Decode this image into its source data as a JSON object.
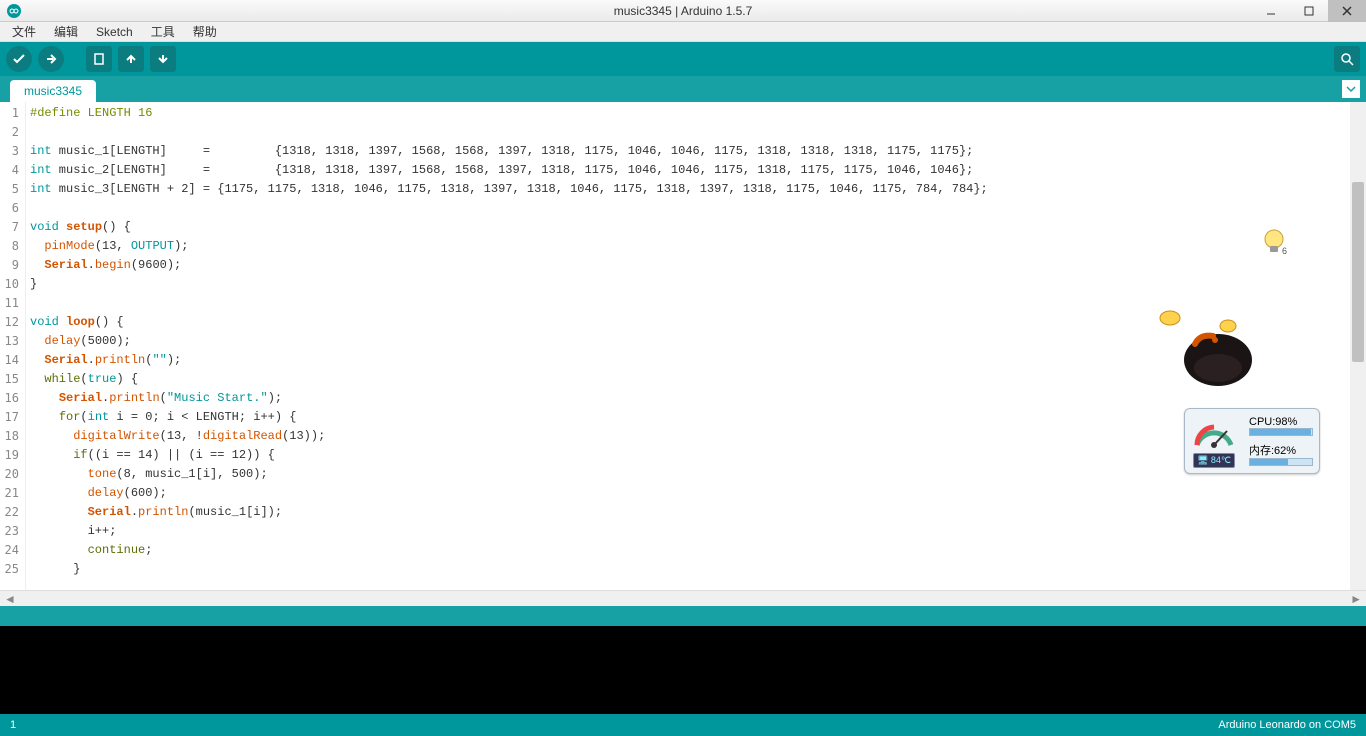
{
  "window": {
    "title": "music3345 | Arduino 1.5.7"
  },
  "menu": {
    "file": "文件",
    "edit": "编辑",
    "sketch": "Sketch",
    "tools": "工具",
    "help": "帮助"
  },
  "tab": {
    "name": "music3345"
  },
  "status": {
    "line": "1",
    "board": "Arduino Leonardo on COM5"
  },
  "gauge": {
    "cpu_label": "CPU:98%",
    "mem_label": "内存:62%",
    "temp": "84℃",
    "cpu_pct": 98,
    "mem_pct": 62
  },
  "bulb_badge": "6",
  "code_lines": [
    {
      "n": 1,
      "html": "<span class='kw-pre'>#define LENGTH 16</span>"
    },
    {
      "n": 2,
      "html": ""
    },
    {
      "n": 3,
      "html": "<span class='kw-type'>int</span> music_1[LENGTH]     =         {1318, 1318, 1397, 1568, 1568, 1397, 1318, 1175, 1046, 1046, 1175, 1318, 1318, 1318, 1175, 1175};"
    },
    {
      "n": 4,
      "html": "<span class='kw-type'>int</span> music_2[LENGTH]     =         {1318, 1318, 1397, 1568, 1568, 1397, 1318, 1175, 1046, 1046, 1175, 1318, 1175, 1175, 1046, 1046};"
    },
    {
      "n": 5,
      "html": "<span class='kw-type'>int</span> music_3[LENGTH + 2] = {1175, 1175, 1318, 1046, 1175, 1318, 1397, 1318, 1046, 1175, 1318, 1397, 1318, 1175, 1046, 1175, 784, 784};"
    },
    {
      "n": 6,
      "html": ""
    },
    {
      "n": 7,
      "html": "<span class='kw-type'>void</span> <span class='kw-func'>setup</span>() {"
    },
    {
      "n": 8,
      "html": "  <span class='kw-fn2'>pinMode</span>(13, <span class='kw-const'>OUTPUT</span>);"
    },
    {
      "n": 9,
      "html": "  <span class='kw-class'>Serial</span>.<span class='kw-fn2'>begin</span>(9600);"
    },
    {
      "n": 10,
      "html": "}"
    },
    {
      "n": 11,
      "html": ""
    },
    {
      "n": 12,
      "html": "<span class='kw-type'>void</span> <span class='kw-func'>loop</span>() {"
    },
    {
      "n": 13,
      "html": "  <span class='kw-fn2'>delay</span>(5000);"
    },
    {
      "n": 14,
      "html": "  <span class='kw-class'>Serial</span>.<span class='kw-fn2'>println</span>(<span class='str'>\"\"</span>);"
    },
    {
      "n": 15,
      "html": "  <span class='kw-ctrl'>while</span>(<span class='kw-type'>true</span>) {"
    },
    {
      "n": 16,
      "html": "    <span class='kw-class'>Serial</span>.<span class='kw-fn2'>println</span>(<span class='str'>\"Music Start.\"</span>);"
    },
    {
      "n": 17,
      "html": "    <span class='kw-ctrl'>for</span>(<span class='kw-type'>int</span> i = 0; i &lt; LENGTH; i++) {"
    },
    {
      "n": 18,
      "html": "      <span class='kw-fn2'>digitalWrite</span>(13, !<span class='kw-fn2'>digitalRead</span>(13));"
    },
    {
      "n": 19,
      "html": "      <span class='kw-ctrl'>if</span>((i == 14) || (i == 12)) {"
    },
    {
      "n": 20,
      "html": "        <span class='kw-fn2'>tone</span>(8, music_1[i], 500);"
    },
    {
      "n": 21,
      "html": "        <span class='kw-fn2'>delay</span>(600);"
    },
    {
      "n": 22,
      "html": "        <span class='kw-class'>Serial</span>.<span class='kw-fn2'>println</span>(music_1[i]);"
    },
    {
      "n": 23,
      "html": "        i++;"
    },
    {
      "n": 24,
      "html": "        <span class='kw-ctrl'>continue</span>;"
    },
    {
      "n": 25,
      "html": "      }"
    }
  ]
}
